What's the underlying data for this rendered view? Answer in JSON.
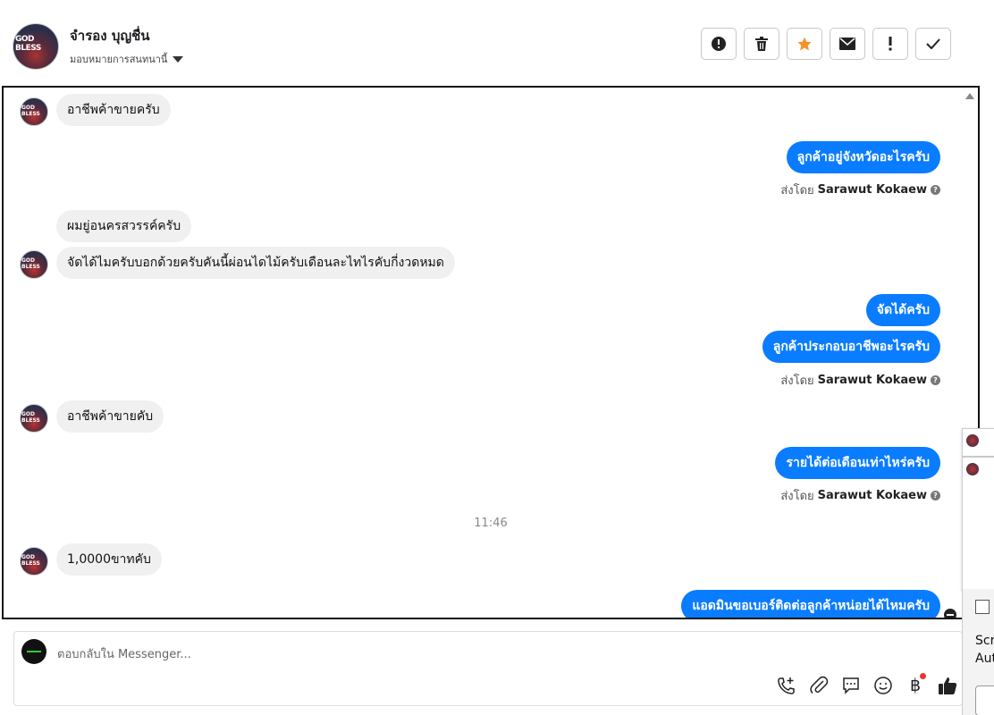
{
  "header": {
    "contact_name": "จำรอง บุญชื่น",
    "avatar_text": "GOD BLESS",
    "assign_label": "มอบหมายการสนทนานี้",
    "actions": [
      {
        "name": "spam-button",
        "icon": "exclamation-circle-icon"
      },
      {
        "name": "delete-button",
        "icon": "trash-icon"
      },
      {
        "name": "star-button",
        "icon": "star-icon"
      },
      {
        "name": "mark-unread-button",
        "icon": "envelope-icon"
      },
      {
        "name": "follow-up-button",
        "icon": "exclamation-icon"
      },
      {
        "name": "mark-done-button",
        "icon": "check-icon"
      }
    ]
  },
  "conversation": {
    "messages": [
      {
        "dir": "in",
        "text": "อาชีพค้าขายครับ",
        "avatar": true
      },
      {
        "dir": "out",
        "text": "ลูกค้าอยู่จังหวัดอะไรครับ"
      },
      {
        "sent_by_prefix": "ส่งโดย",
        "sent_by_name": "Sarawut Kokaew"
      },
      {
        "dir": "in",
        "text": "ผมยู่อนครสวรรค์ครับ",
        "avatar": false
      },
      {
        "dir": "in",
        "text": "จัดได้ไมครับบอกด้วยครับคันนี้ผ่อนไดไม้ครับเดือนละไทไรคับกี่งวดหมด",
        "avatar": true
      },
      {
        "dir": "out",
        "text": "จัดได้ครับ"
      },
      {
        "dir": "out",
        "text": "ลูกค้าประกอบอาชีพอะไรครับ"
      },
      {
        "sent_by_prefix": "ส่งโดย",
        "sent_by_name": "Sarawut Kokaew"
      },
      {
        "dir": "in",
        "text": "อาชีพค้าขายคับ",
        "avatar": true
      },
      {
        "dir": "out",
        "text": "รายได้ต่อเดือนเท่าไหร่ครับ"
      },
      {
        "sent_by_prefix": "ส่งโดย",
        "sent_by_name": "Sarawut Kokaew"
      },
      {
        "dir": "in",
        "text": "1,0000ขาทคับ",
        "avatar": true
      },
      {
        "dir": "out",
        "text": "แอดมินขอเบอร์ติดต่อลูกค้าหน่อยได้ไหมครับ"
      }
    ],
    "timestamp": "11:46"
  },
  "composer": {
    "placeholder": "ตอบกลับใน Messenger...",
    "tools": [
      "phone-add-icon",
      "paperclip-icon",
      "chat-reply-icon",
      "emoji-icon",
      "baht-payment-icon",
      "thumbs-up-icon"
    ]
  },
  "side": {
    "line1": "Scre",
    "line2": "Aut"
  }
}
